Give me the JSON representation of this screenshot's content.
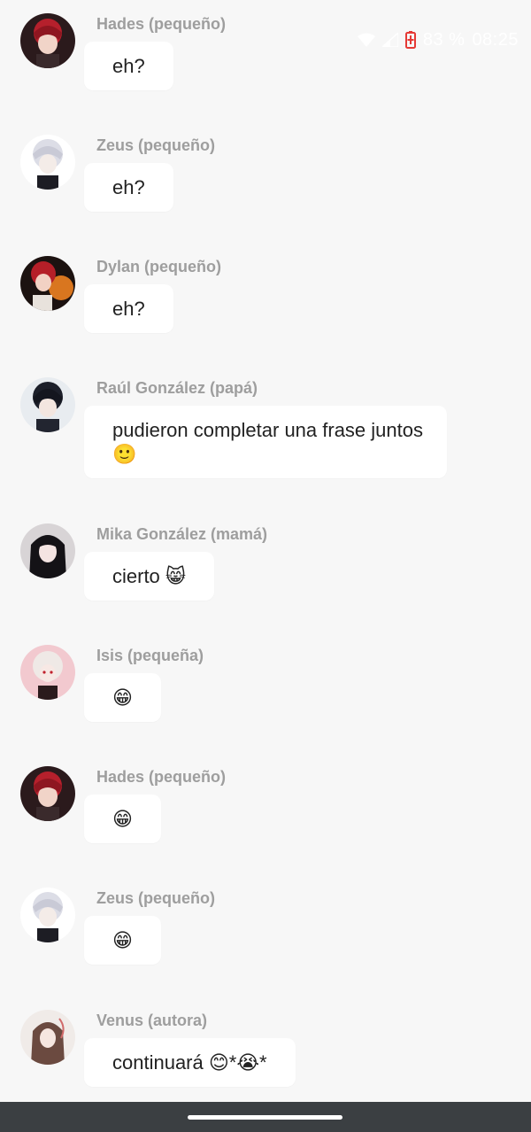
{
  "status_bar": {
    "battery_percent": "83 %",
    "time": "08:25",
    "battery_color": "#e53935",
    "icons": [
      "wifi-icon",
      "signal-icon",
      "battery-icon"
    ]
  },
  "messages": [
    {
      "sender": "Hades (pequeño)",
      "text": "eh?",
      "avatar": "avatar-hades"
    },
    {
      "sender": "Zeus (pequeño)",
      "text": "eh?",
      "avatar": "avatar-zeus"
    },
    {
      "sender": "Dylan (pequeño)",
      "text": "eh?",
      "avatar": "avatar-dylan"
    },
    {
      "sender": "Raúl González (papá)",
      "text": "pudieron completar una frase juntos 🙂",
      "avatar": "avatar-raul"
    },
    {
      "sender": "Mika González (mamá)",
      "text": "cierto 😸",
      "avatar": "avatar-mika"
    },
    {
      "sender": "Isis (pequeña)",
      "text": "😁",
      "avatar": "avatar-isis"
    },
    {
      "sender": "Hades (pequeño)",
      "text": "😁",
      "avatar": "avatar-hades"
    },
    {
      "sender": "Zeus (pequeño)",
      "text": "😁",
      "avatar": "avatar-zeus"
    },
    {
      "sender": "Venus (autora)",
      "text": "continuará 😊*😭*",
      "avatar": "avatar-venus"
    }
  ]
}
